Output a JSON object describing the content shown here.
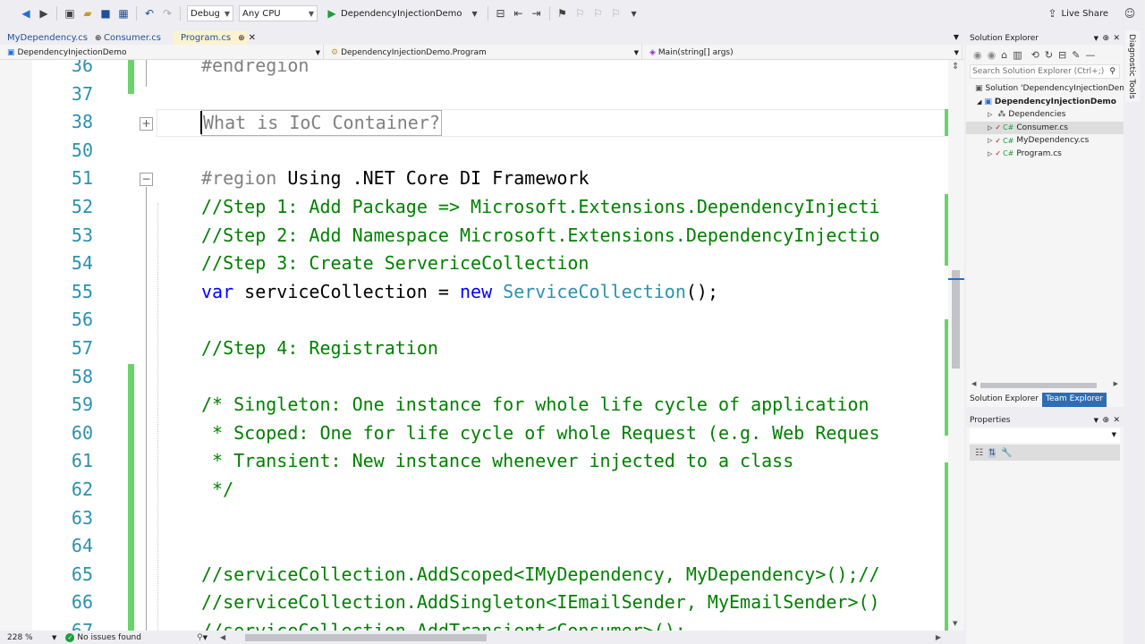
{
  "toolbar": {
    "config": "Debug",
    "platform": "Any CPU",
    "startup_project": "DependencyInjectionDemo",
    "live_share": "Live Share"
  },
  "tabs": [
    {
      "label": "MyDependency.cs",
      "marker": "⊕"
    },
    {
      "label": "Consumer.cs",
      "marker": ""
    },
    {
      "label": "Program.cs",
      "marker": "⊕ ✕"
    }
  ],
  "nav": {
    "project": "DependencyInjectionDemo",
    "class": "DependencyInjectionDemo.Program",
    "member": "Main(string[] args)"
  },
  "lines": [
    {
      "num": "36",
      "code": "#endregion"
    },
    {
      "num": "37",
      "code": ""
    },
    {
      "num": "38",
      "code": "What is IoC Container?"
    },
    {
      "num": "50",
      "code": ""
    },
    {
      "num": "51",
      "code_a": "#region",
      "code_b": " Using .NET Core DI Framework"
    },
    {
      "num": "52",
      "code": "//Step 1: Add Package => Microsoft.Extensions.DependencyInjecti"
    },
    {
      "num": "53",
      "code": "//Step 2: Add Namespace Microsoft.Extensions.DependencyInjectio"
    },
    {
      "num": "54",
      "code": "//Step 3: Create ServericeCollection"
    },
    {
      "num": "55",
      "code_kw": "var",
      "code_mid": " serviceCollection = ",
      "code_kw2": "new",
      "code_cls": " ServiceCollection",
      "code_end": "();"
    },
    {
      "num": "56",
      "code": ""
    },
    {
      "num": "57",
      "code": "//Step 4: Registration"
    },
    {
      "num": "58",
      "code": ""
    },
    {
      "num": "59",
      "code": "/* Singleton: One instance for whole life cycle of application"
    },
    {
      "num": "60",
      "code": " * Scoped: One for life cycle of whole Request (e.g. Web Reques"
    },
    {
      "num": "61",
      "code": " * Transient: New instance whenever injected to a class"
    },
    {
      "num": "62",
      "code": " */"
    },
    {
      "num": "63",
      "code": ""
    },
    {
      "num": "64",
      "code": ""
    },
    {
      "num": "65",
      "code": "//serviceCollection.AddScoped<IMyDependency, MyDependency>();//"
    },
    {
      "num": "66",
      "code": "//serviceCollection.AddSingleton<IEmailSender, MyEmailSender>()"
    },
    {
      "num": "67",
      "code": "//serviceCollection.AddTransient<Consumer>();"
    }
  ],
  "status": {
    "zoom": "228 %",
    "issues": "No issues found"
  },
  "solution_explorer": {
    "title": "Solution Explorer",
    "search_placeholder": "Search Solution Explorer (Ctrl+;)",
    "solution": "Solution 'DependencyInjectionDemo' (",
    "project": "DependencyInjectionDemo",
    "items": [
      "Dependencies",
      "Consumer.cs",
      "MyDependency.cs",
      "Program.cs"
    ],
    "tab_active": "Solution Explorer",
    "tab_other": "Team Explorer"
  },
  "properties": {
    "title": "Properties"
  },
  "diagnostic": "Diagnostic Tools"
}
